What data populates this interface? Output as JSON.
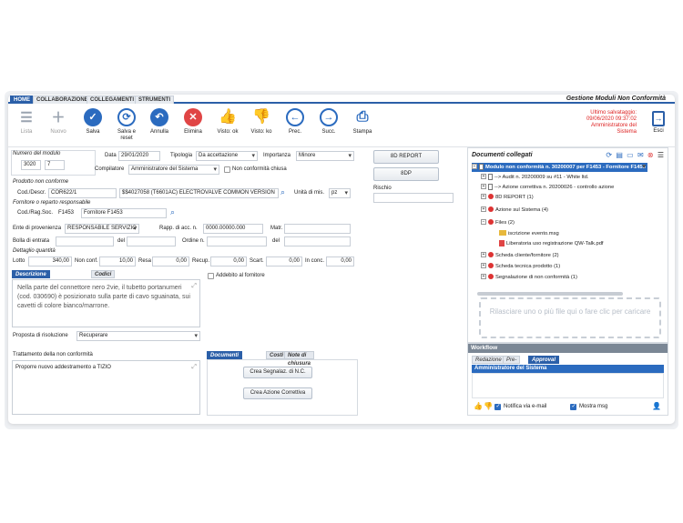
{
  "ribbon": {
    "tabs": [
      "HOME",
      "COLLABORAZIONE",
      "COLLEGAMENTI",
      "STRUMENTI"
    ],
    "app_title": "Gestione Moduli Non Conformità"
  },
  "toolbar": {
    "lista": "Lista",
    "nuovo": "Nuovo",
    "salva": "Salva",
    "salva_reset": "Salva e reset",
    "annulla": "Annulla",
    "elimina": "Elimina",
    "visto_ok": "Visto: ok",
    "visto_ko": "Visto: ko",
    "prec": "Prec.",
    "succ": "Succ.",
    "stampa": "Stampa",
    "esci": "Esci",
    "last_save": [
      "Ultimo salvataggio:",
      "09/06/2020 09:37:02",
      "Amministratore del",
      "Sistema"
    ]
  },
  "form": {
    "numero_label": "Numero del modulo",
    "numero_anno": "3020",
    "numero_num": "7",
    "data_label": "Data",
    "data_value": "29/01/2020",
    "tipologia_label": "Tipologia",
    "tipologia_value": "Da accettazione",
    "importanza_label": "Importanza",
    "importanza_value": "Minore",
    "compilatore_label": "Compilatore",
    "compilatore_value": "Amministratore del Sistema",
    "nc_chiusa_label": "Non conformità chiusa",
    "prodotto_label": "Prodotto non conforme",
    "cod_descr_label": "Cod./Descr.",
    "cod_value": "COR622/1",
    "descr_value": "$$4027058 (T6601AC) ELECTROVALVE COMMON VERSION",
    "unita_label": "Unità di mis.",
    "unita_value": "pz",
    "fornitore_label": "Fornitore o reparto responsabile",
    "cod_rag_label": "Cod./Rag.Soc.",
    "forn_cod": "F1453",
    "forn_nome": "Fornitore F1453",
    "ente_label": "Ente di provenienza",
    "ente_value": "RESPONSABILE SERVIZIO P...",
    "rapp_label": "Rapp. di acc. n.",
    "rapp_value": "0000.00000.000",
    "matr_label": "Matr.",
    "bolla_label": "Bolla di entrata",
    "bolla_del": "del",
    "ordine_label": "Ordine n.",
    "ordine_del": "del",
    "dettaglio_label": "Dettaglio quantità",
    "lotto_label": "Lotto",
    "lotto_value": "340,00",
    "nonconf_label": "Non conf.",
    "nonconf_value": "10,00",
    "resa_label": "Resa",
    "resa_value": "0,00",
    "recup_label": "Recup.",
    "recup_value": "0,00",
    "scart_label": "Scart.",
    "scart_value": "0,00",
    "inconc_label": "In conc.",
    "inconc_value": "0,00",
    "addebito_label": "Addebito al fornitore",
    "report_8d": "8D REPORT",
    "dp_8": "8DP",
    "rischio_label": "Rischio",
    "desc_tabs": [
      "Descrizione non conformità",
      "Codici"
    ],
    "descrizione": "Nella parte del connettore nero 2vie, il tubetto portanumeri (cod. 030690) è posizionato sulla parte di cavo sguainata, sui cavetti di colore bianco/marrone.",
    "proposta_label": "Proposta di risoluzione",
    "proposta_value": "Recuperare",
    "trattamento_label": "Trattamento della non conformità",
    "trattamento_value": "Proporre nuovo addestramento a TIZIO",
    "doc_tabs": [
      "Documenti collegati",
      "Costi",
      "Note di chiusura"
    ],
    "crea_segnalaz": "Crea Segnalaz. di N.C.",
    "crea_azione": "Crea Azione Correttiva"
  },
  "documents": {
    "title": "Documenti collegati",
    "tree": [
      "Modulo non conformità n. 30200007 per F1453 - Fornitore F1453",
      "--> Audit n. 20200009 su #11 - White ltd.",
      "--> Azione correttiva n. 20200026 - controllo azione",
      "8D REPORT (1)",
      "Azione sul Sistema (4)",
      "Files (2)",
      "iscrizione evento.msg",
      "Liberatoria uso registrazione QW-Talk.pdf",
      "Scheda cliente/fornitore (2)",
      "Scheda tecnica prodotto (1)",
      "Segnalazione di non conformità (1)"
    ],
    "dropzone": "Rilasciare uno o più file qui o fare clic per caricare"
  },
  "workflow": {
    "title": "Workflow",
    "tabs": [
      "Redazione",
      "Pre-test",
      "Approval"
    ],
    "row": "Amministratore del Sistema",
    "notifica": "Notifica via e-mail",
    "mostra": "Mostra msg"
  }
}
